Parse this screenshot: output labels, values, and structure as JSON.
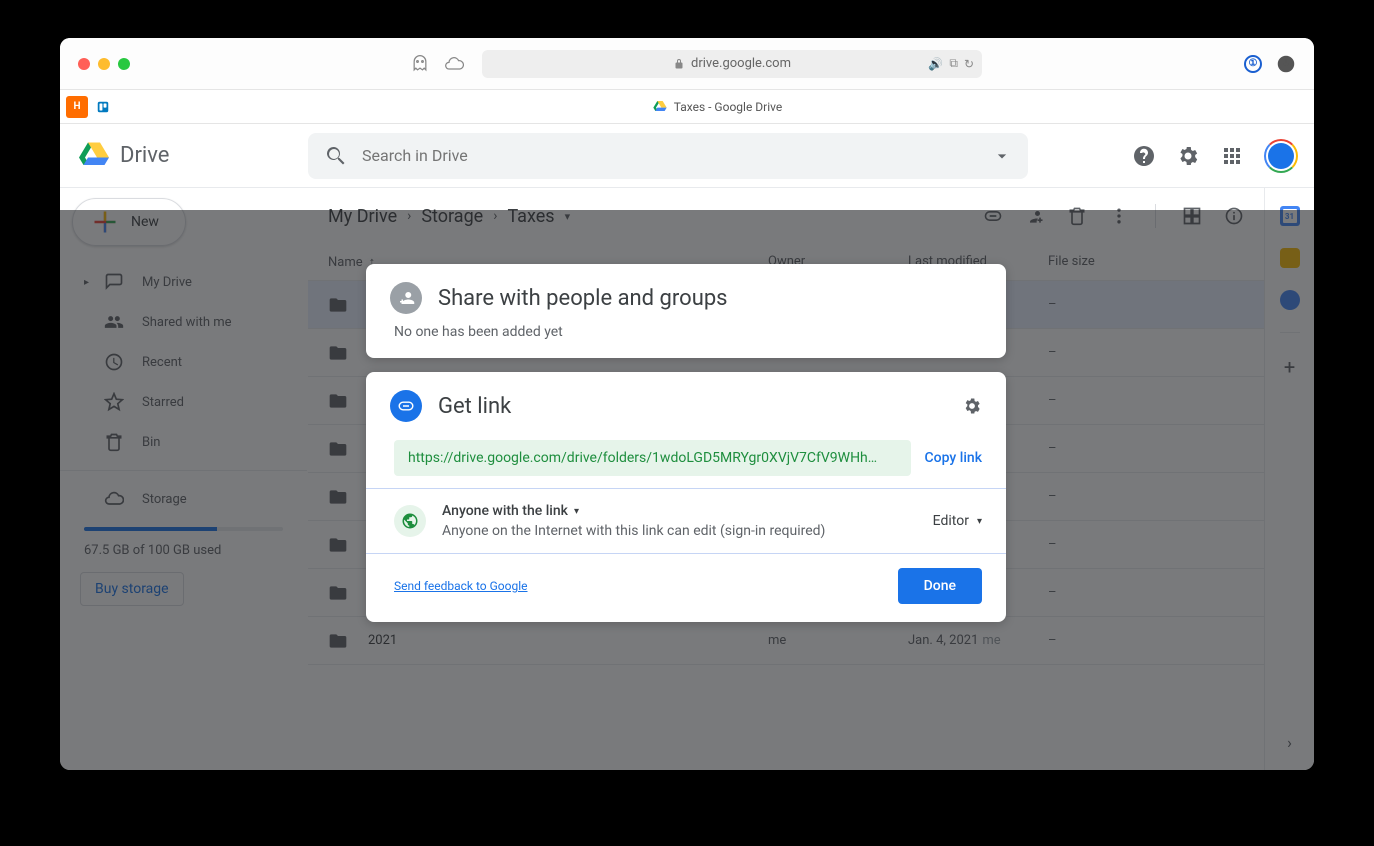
{
  "browser": {
    "url": "drive.google.com",
    "tab_title": "Taxes - Google Drive"
  },
  "app": {
    "logo_text": "Drive",
    "search_placeholder": "Search in Drive"
  },
  "sidebar": {
    "new_label": "New",
    "items": [
      {
        "label": "My Drive"
      },
      {
        "label": "Shared with me"
      },
      {
        "label": "Recent"
      },
      {
        "label": "Starred"
      },
      {
        "label": "Bin"
      }
    ],
    "storage_label": "Storage",
    "storage_used": "67.5 GB of 100 GB used",
    "buy_label": "Buy storage"
  },
  "breadcrumb": {
    "items": [
      "My Drive",
      "Storage",
      "Taxes"
    ]
  },
  "columns": {
    "name": "Name",
    "owner": "Owner",
    "modified": "Last modified",
    "size": "File size"
  },
  "rows": [
    {
      "name": "",
      "owner": "",
      "modified": "",
      "by": "",
      "size": "–",
      "selected": true
    },
    {
      "name": "",
      "owner": "",
      "modified": "",
      "by": "",
      "size": "–"
    },
    {
      "name": "",
      "owner": "",
      "modified": "",
      "by": "",
      "size": "–"
    },
    {
      "name": "",
      "owner": "",
      "modified": "",
      "by": "",
      "size": "–"
    },
    {
      "name": "",
      "owner": "",
      "modified": "",
      "by": "",
      "size": "–"
    },
    {
      "name": "",
      "owner": "",
      "modified": "",
      "by": "",
      "size": "–"
    },
    {
      "name": "",
      "owner": "",
      "modified": "",
      "by": "",
      "size": "–"
    },
    {
      "name": "2021",
      "owner": "me",
      "modified": "Jan. 4, 2021",
      "by": "me",
      "size": "–"
    }
  ],
  "modal": {
    "share_title": "Share with people and groups",
    "share_sub": "No one has been added yet",
    "getlink_title": "Get link",
    "link_url": "https://drive.google.com/drive/folders/1wdoLGD5MRYgr0XVjV7CfV9WHh…",
    "copy_label": "Copy link",
    "access_label": "Anyone with the link",
    "access_desc": "Anyone on the Internet with this link can edit (sign-in required)",
    "role": "Editor",
    "feedback": "Send feedback to Google",
    "done": "Done"
  }
}
